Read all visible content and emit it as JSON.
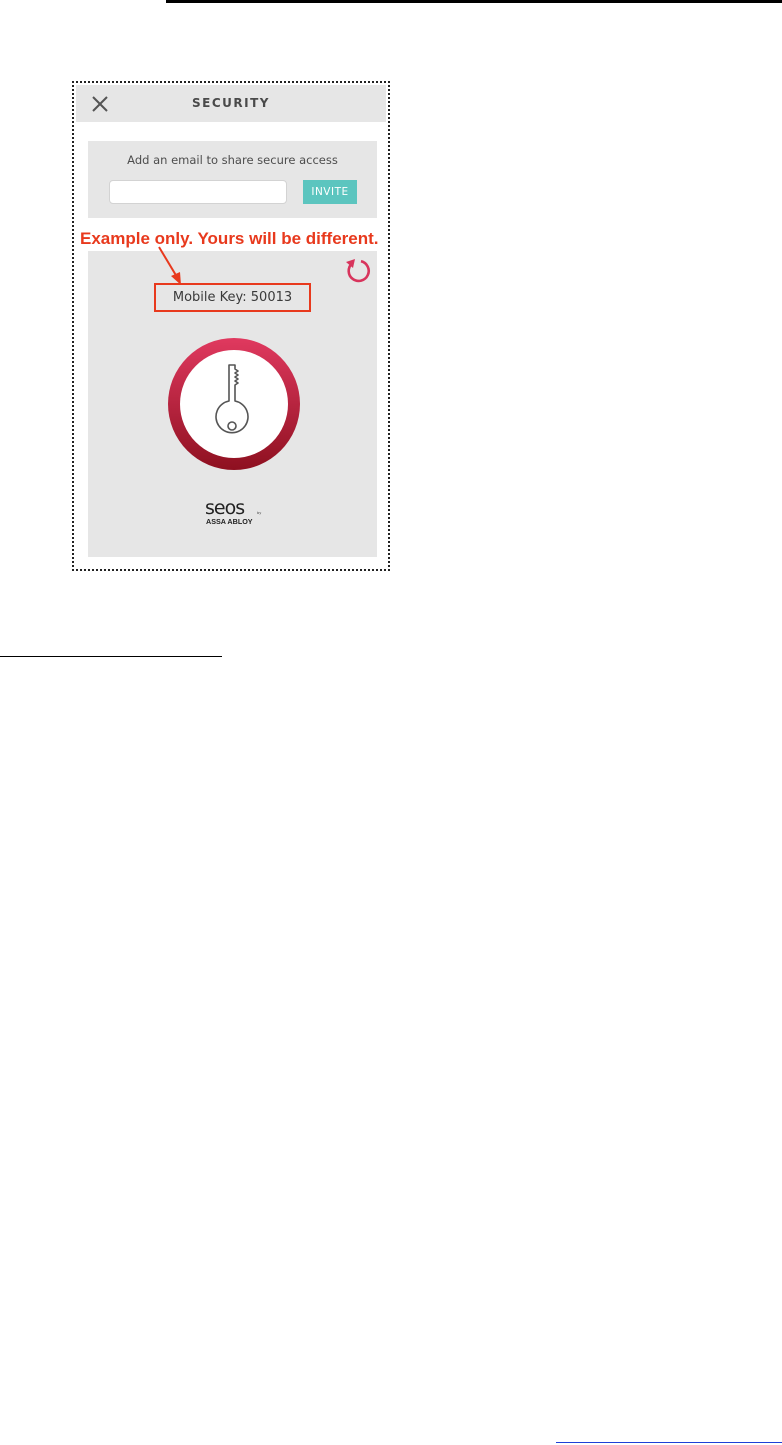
{
  "header": {
    "title": "SECURITY"
  },
  "share": {
    "label": "Add an email to share secure access",
    "email_value": "",
    "invite_label": "INVITE"
  },
  "mobile_key": {
    "text": "Mobile Key: 50013"
  },
  "annotation": {
    "text": "Example only. Yours will be different."
  },
  "icons": {
    "close": "close-icon",
    "refresh": "refresh-icon",
    "key": "key-icon"
  },
  "logo": {
    "text": "seos by ASSA ABLOY"
  },
  "colors": {
    "invite_button": "#5cc5bf",
    "annotation": "#e8391d",
    "key_ring_top": "#e0395f",
    "key_ring_bottom": "#8e1020"
  }
}
